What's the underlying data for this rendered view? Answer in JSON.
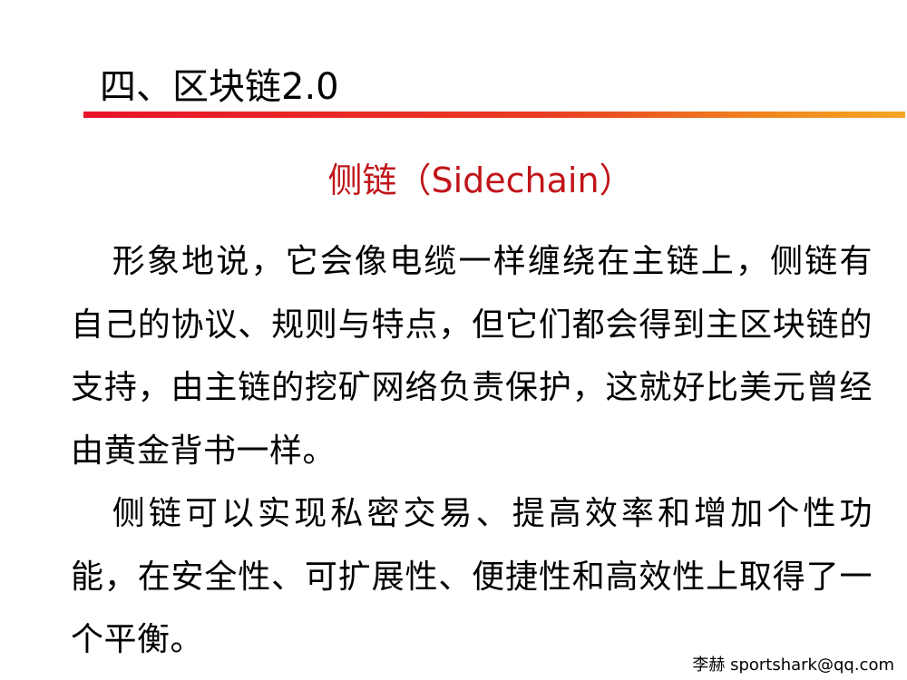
{
  "slide": {
    "title": "四、区块链2.0",
    "subtitle": "侧链（Sidechain）",
    "paragraphs": [
      "形象地说，它会像电缆一样缠绕在主链上，侧链有自己的协议、规则与特点，但它们都会得到主区块链的支持，由主链的挖矿网络负责保护，这就好比美元曾经由黄金背书一样。",
      "侧链可以实现私密交易、提高效率和增加个性功能，在安全性、可扩展性、便捷性和高效性上取得了一个平衡。"
    ],
    "footer": "李赫 sportshark@qq.com"
  },
  "colors": {
    "subtitle": "#c0141a",
    "rule_start": "#e8132a",
    "rule_end": "#f4a623"
  }
}
